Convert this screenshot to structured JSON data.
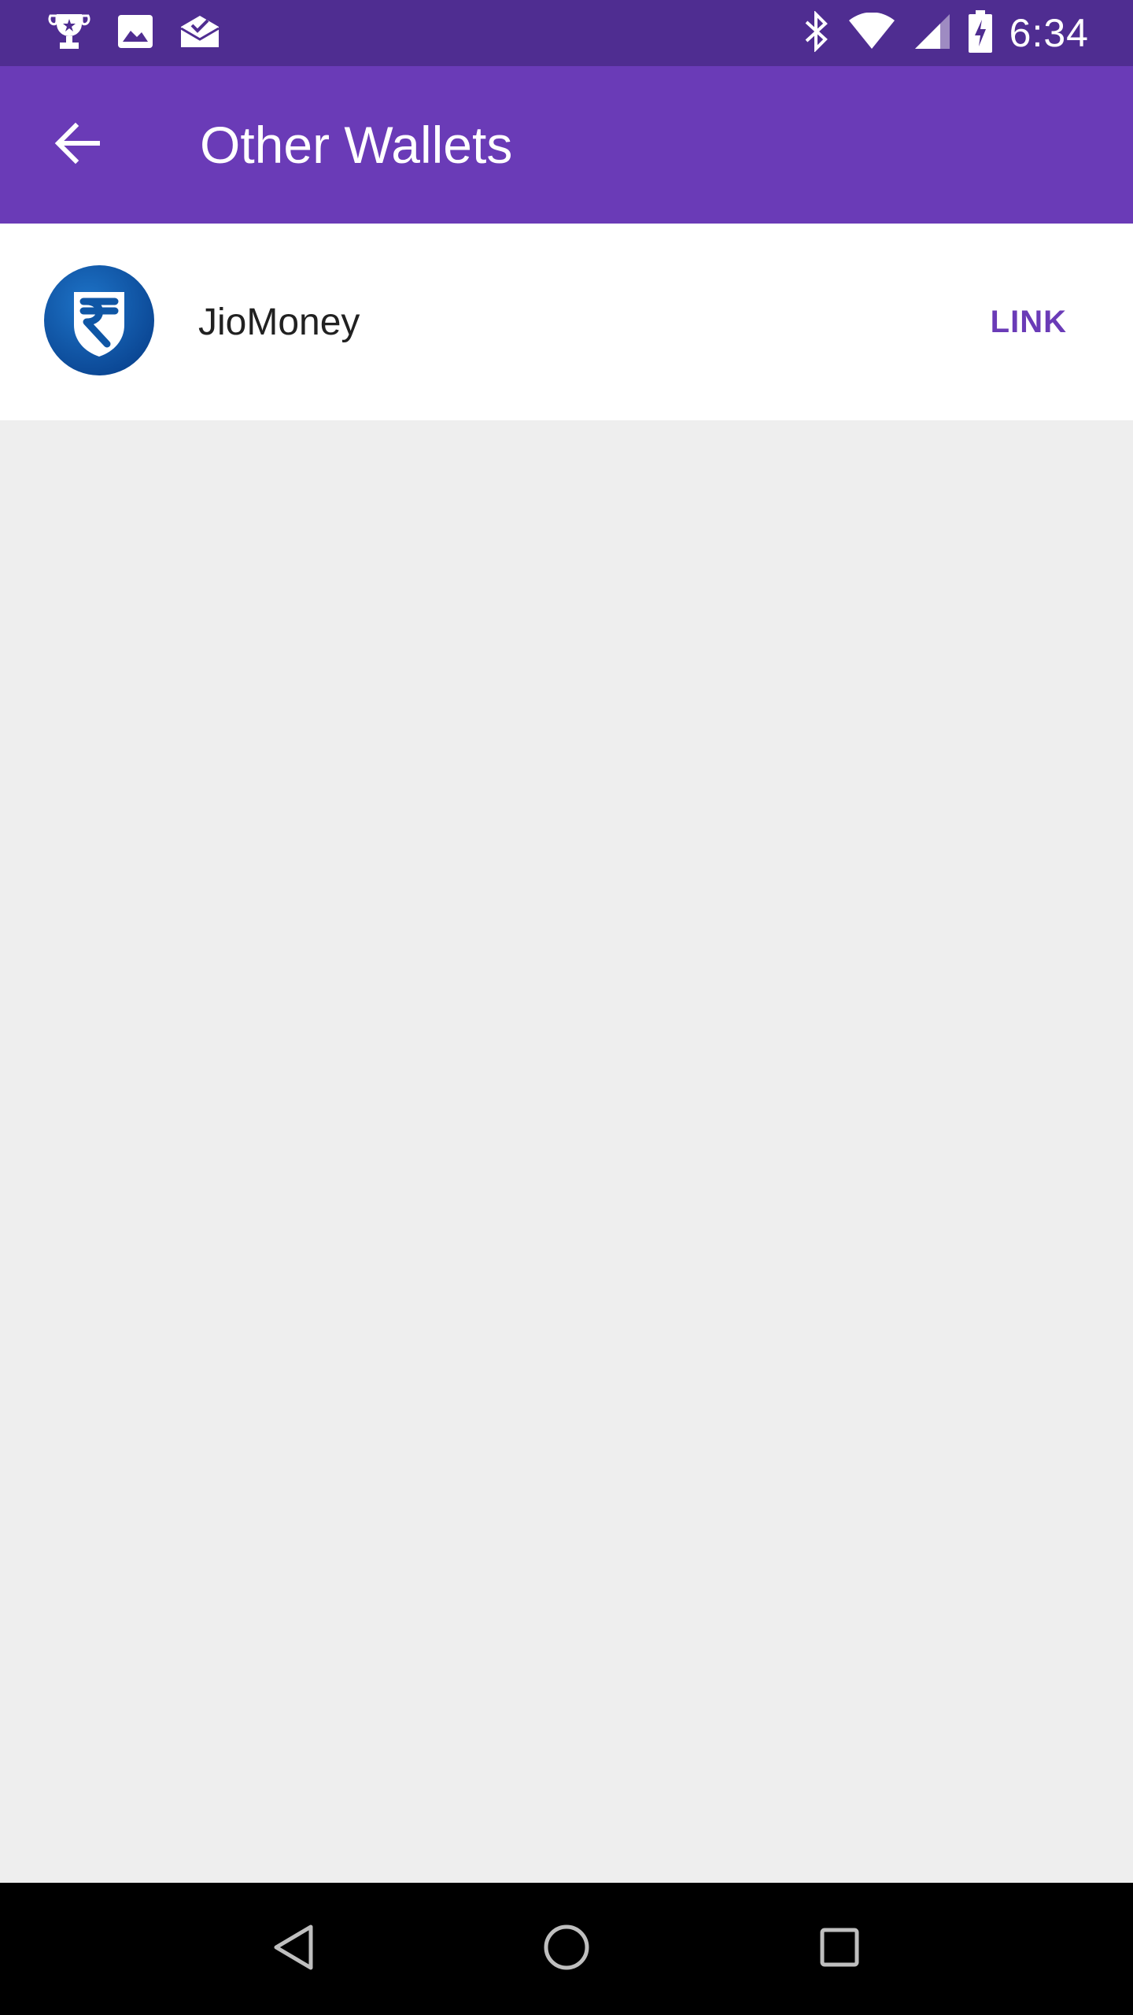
{
  "status_bar": {
    "time": "6:34",
    "left_icons": [
      "trophy-icon",
      "image-icon",
      "mail-check-icon"
    ],
    "right_icons": [
      "bluetooth-icon",
      "wifi-icon",
      "signal-icon",
      "battery-charging-icon"
    ]
  },
  "app_bar": {
    "title": "Other Wallets",
    "back_icon": "arrow-back-icon"
  },
  "wallets": [
    {
      "name": "JioMoney",
      "action": "LINK",
      "logo_icon": "rupee-shield-icon"
    }
  ],
  "nav_bar": {
    "icons": [
      "back-triangle-icon",
      "home-circle-icon",
      "recents-square-icon"
    ]
  },
  "colors": {
    "status_bar": "#4f2d91",
    "app_bar": "#6a3bb7",
    "accent": "#6a3bb7",
    "background": "#eeeeee",
    "logo_blue": "#0f56a5"
  }
}
